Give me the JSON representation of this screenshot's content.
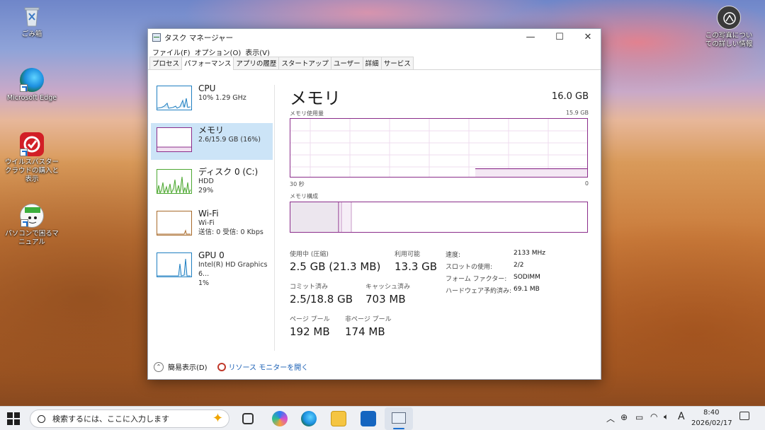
{
  "desktop": {
    "icons": [
      {
        "label": "ごみ箱"
      },
      {
        "label": "Microsoft Edge"
      },
      {
        "label": "ウイルスバスター クラウドの購入と表示"
      },
      {
        "label": "パソコンで困るマニュアル"
      }
    ],
    "spotlight_label": "この写真についての詳しい情報"
  },
  "window": {
    "title": "タスク マネージャー",
    "controls": {
      "minimize": "—",
      "maximize": "☐",
      "close": "✕"
    },
    "menu": [
      "ファイル(F)",
      "オプション(O)",
      "表示(V)"
    ],
    "tabs": [
      "プロセス",
      "パフォーマンス",
      "アプリの履歴",
      "スタートアップ",
      "ユーザー",
      "詳細",
      "サービス"
    ],
    "active_tab": "パフォーマンス"
  },
  "sidebar": [
    {
      "title": "CPU",
      "line1": "10% 1.29 GHz",
      "line2": "",
      "color": "#1f7fc1"
    },
    {
      "title": "メモリ",
      "line1": "2.6/15.9 GB (16%)",
      "line2": "",
      "color": "#8b2d8b"
    },
    {
      "title": "ディスク 0 (C:)",
      "line1": "HDD",
      "line2": "29%",
      "color": "#4da832"
    },
    {
      "title": "Wi-Fi",
      "line1": "Wi-Fi",
      "line2": "送信: 0 受信: 0 Kbps",
      "color": "#a86a2a"
    },
    {
      "title": "GPU 0",
      "line1": "Intel(R) HD Graphics 6...",
      "line2": "1%",
      "color": "#1f7fc1"
    }
  ],
  "memory": {
    "title": "メモリ",
    "total": "16.0 GB",
    "usage_label": "メモリ使用量",
    "usage_max": "15.9 GB",
    "time_left": "30 秒",
    "time_right": "0",
    "composition_label": "メモリ構成",
    "in_use_fraction": 0.16,
    "stats": {
      "in_use_label": "使用中 (圧縮)",
      "in_use_value": "2.5 GB (21.3 MB)",
      "available_label": "利用可能",
      "available_value": "13.3 GB",
      "committed_label": "コミット済み",
      "committed_value": "2.5/18.8 GB",
      "cached_label": "キャッシュ済み",
      "cached_value": "703 MB",
      "paged_label": "ページ プール",
      "paged_value": "192 MB",
      "nonpaged_label": "非ページ プール",
      "nonpaged_value": "174 MB"
    },
    "details": [
      {
        "k": "速度:",
        "v": "2133 MHz"
      },
      {
        "k": "スロットの使用:",
        "v": "2/2"
      },
      {
        "k": "フォーム ファクター:",
        "v": "SODIMM"
      },
      {
        "k": "ハードウェア予約済み:",
        "v": "69.1 MB"
      }
    ]
  },
  "footer": {
    "fewer_details": "簡易表示(D)",
    "resource_monitor": "リソース モニターを開く"
  },
  "taskbar": {
    "search_placeholder": "検索するには、ここに入力します",
    "time": "8:40",
    "date": "2026/02/17",
    "ime": "A"
  }
}
